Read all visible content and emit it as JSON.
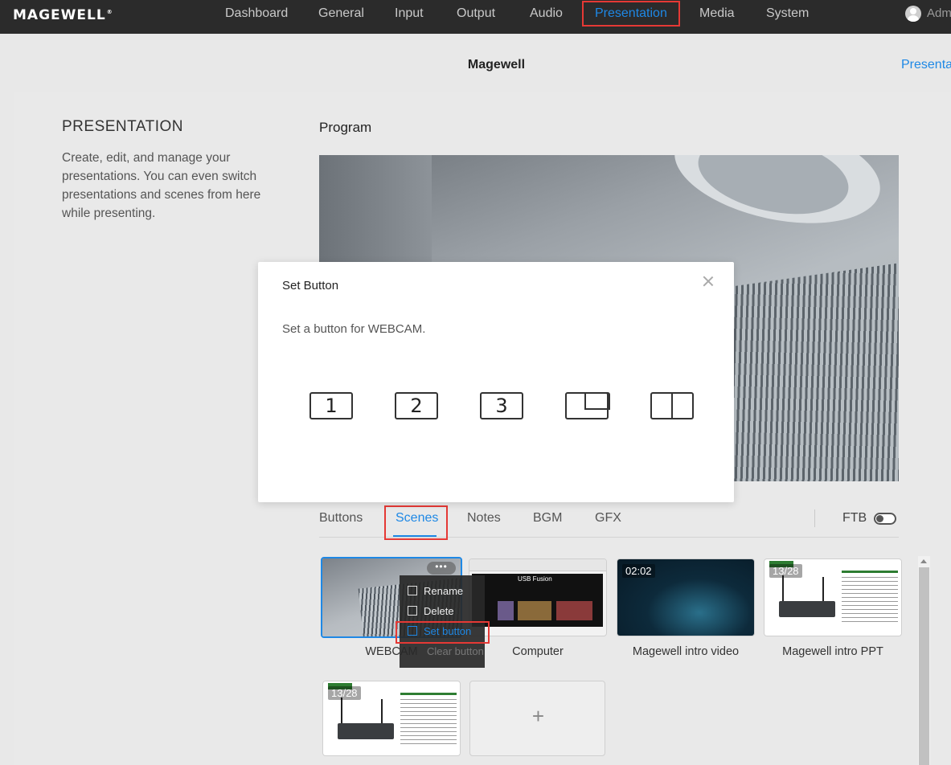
{
  "nav": {
    "logo": "MAGEWELL",
    "items": [
      "Dashboard",
      "General",
      "Input",
      "Output",
      "Audio",
      "Presentation",
      "Media",
      "System"
    ],
    "active": "Presentation",
    "user": "Adm"
  },
  "subheader": {
    "title": "Magewell",
    "link": "Presenta"
  },
  "section": {
    "title": "PRESENTATION",
    "description": "Create, edit, and manage your presentations. You can even switch presentations and scenes from here while presenting."
  },
  "program_label": "Program",
  "dialog": {
    "title": "Set Button",
    "message": "Set a button for WEBCAM.",
    "options": [
      "1",
      "2",
      "3",
      "pip-layout",
      "split-layout"
    ]
  },
  "tabs": [
    "Buttons",
    "Scenes",
    "Notes",
    "BGM",
    "GFX"
  ],
  "active_tab": "Scenes",
  "ftb_label": "FTB",
  "ftb_on": false,
  "scenes": [
    {
      "name": "WEBCAM",
      "selected": true,
      "badge": ""
    },
    {
      "name": "Computer",
      "selected": false,
      "badge": ""
    },
    {
      "name": "Magewell intro video",
      "selected": false,
      "badge": "02:02"
    },
    {
      "name": "Magewell intro PPT",
      "selected": false,
      "badge": "13/28"
    },
    {
      "name": "",
      "selected": false,
      "badge": "13/28"
    }
  ],
  "computer_thumb_text": "USB Fusion",
  "more_dots": "•••",
  "add_symbol": "+",
  "context_menu": {
    "items": [
      "Rename",
      "Delete",
      "Set button",
      "Clear button"
    ],
    "highlighted": "Set button",
    "disabled": "Clear button"
  },
  "colors": {
    "accent": "#1e88e5",
    "highlight_box": "#e53935",
    "topbar": "#2b2b2b"
  }
}
